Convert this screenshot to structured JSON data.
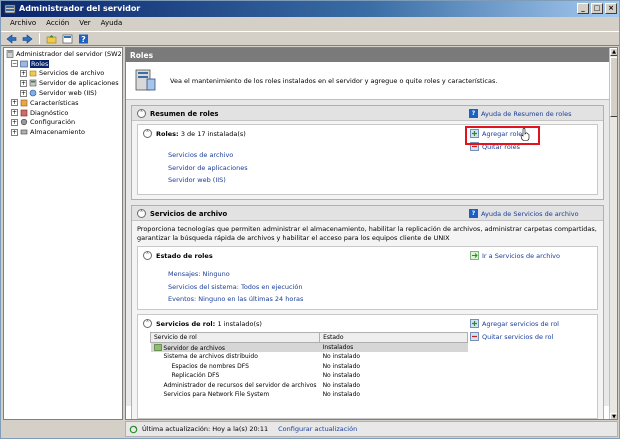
{
  "window": {
    "title": "Administrador del servidor",
    "controls": [
      "_",
      "□",
      "×"
    ]
  },
  "menu": [
    "Archivo",
    "Acción",
    "Ver",
    "Ayuda"
  ],
  "toolbar": [
    "back-icon",
    "forward-icon",
    "up-icon",
    "properties-icon",
    "help-icon"
  ],
  "tree": [
    {
      "label": "Administrador del servidor (SW2K8",
      "level": 0,
      "expander": "",
      "icon": "server-icon"
    },
    {
      "label": "Roles",
      "level": 1,
      "expander": "−",
      "icon": "roles-icon",
      "selected": true
    },
    {
      "label": "Servicios de archivo",
      "level": 2,
      "expander": "+",
      "icon": "file-services-icon"
    },
    {
      "label": "Servidor de aplicaciones",
      "level": 2,
      "expander": "+",
      "icon": "app-server-icon"
    },
    {
      "label": "Servidor web (IIS)",
      "level": 2,
      "expander": "+",
      "icon": "web-server-icon"
    },
    {
      "label": "Características",
      "level": 1,
      "expander": "+",
      "icon": "features-icon"
    },
    {
      "label": "Diagnóstico",
      "level": 1,
      "expander": "+",
      "icon": "diagnostics-icon"
    },
    {
      "label": "Configuración",
      "level": 1,
      "expander": "+",
      "icon": "configuration-icon"
    },
    {
      "label": "Almacenamiento",
      "level": 1,
      "expander": "+",
      "icon": "storage-icon"
    }
  ],
  "content": {
    "header": "Roles",
    "intro": "Vea el mantenimiento de los roles instalados en el servidor y agregue o quite roles y características.",
    "summary": {
      "title": "Resumen de roles",
      "help": "Ayuda de Resumen de roles",
      "roles_label": "Roles:",
      "roles_count": "3 de 17 instalada(s)",
      "roles": [
        "Servicios de archivo",
        "Servidor de aplicaciones",
        "Servidor web (IIS)"
      ],
      "add_roles": "Agregar roles",
      "remove_roles": "Quitar roles"
    },
    "file_services": {
      "title": "Servicios de archivo",
      "help": "Ayuda de Servicios de archivo",
      "description": "Proporciona tecnologías que permiten administrar el almacenamiento, habilitar la replicación de archivos, administrar carpetas compartidas, garantizar la búsqueda rápida de archivos y habilitar el acceso para los equipos cliente de UNIX",
      "status": {
        "title": "Estado de roles",
        "goto": "Ir a Servicios de archivo",
        "messages": "Mensajes: Ninguno",
        "system_services": "Servicios del sistema: Todos en ejecución",
        "events": "Eventos: Ninguno en las últimas 24 horas"
      },
      "role_services": {
        "title": "Servicios de rol:",
        "count": "1 instalado(s)",
        "add": "Agregar servicios de rol",
        "remove": "Quitar servicios de rol",
        "columns": [
          "Servicio de rol",
          "Estado"
        ],
        "rows": [
          {
            "name": "Servidor de archivos",
            "state": "Instalados",
            "indent": 0
          },
          {
            "name": "Sistema de archivos distribuido",
            "state": "No instalado",
            "indent": 0
          },
          {
            "name": "Espacios de nombres DFS",
            "state": "No instalado",
            "indent": 1
          },
          {
            "name": "Replicación DFS",
            "state": "No instalado",
            "indent": 1
          },
          {
            "name": "Administrador de recursos del servidor de archivos",
            "state": "No instalado",
            "indent": 0
          },
          {
            "name": "Servicios para Network File System",
            "state": "No instalado",
            "indent": 0
          }
        ]
      }
    }
  },
  "status": {
    "last_update": "Última actualización: Hoy a la(s) 20:11",
    "configure": "Configurar actualización"
  }
}
